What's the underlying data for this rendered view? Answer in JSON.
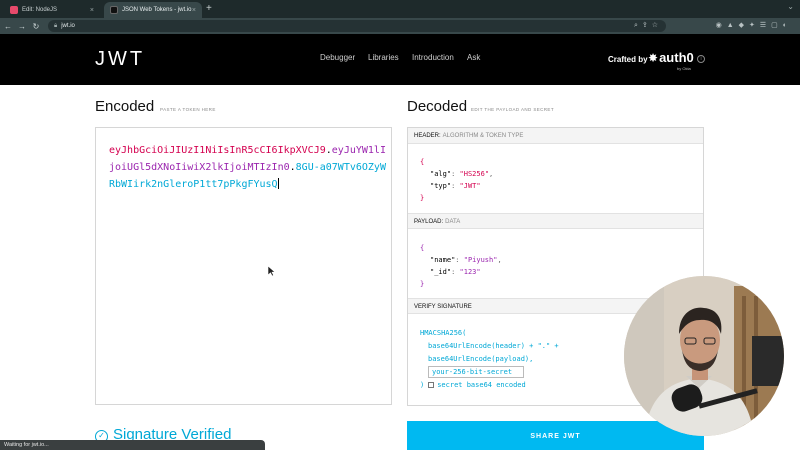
{
  "browser": {
    "tabs": [
      {
        "title": "Edit: NodeJS",
        "close": "×"
      },
      {
        "title": "JSON Web Tokens - jwt.io",
        "close": "×"
      }
    ],
    "new_tab": "+",
    "url": "jwt.io",
    "status_text": "Waiting for jwt.io..."
  },
  "site": {
    "logo": "JWT",
    "nav": [
      "Debugger",
      "Libraries",
      "Introduction",
      "Ask"
    ],
    "crafted_by": "Crafted by",
    "brand": "auth0",
    "brand_sub": "by Okta"
  },
  "encoded": {
    "title": "Encoded",
    "hint": "PASTE A TOKEN HERE",
    "token": {
      "header": "eyJhbGciOiJIUzI1NiIsInR5cCI6IkpXVCJ9",
      "payload": "eyJuYW1lIjoiUGl5dXNoIiwiX2lkIjoiMTIzIn0",
      "signature": "8GU-a07WTv6OZyWRbWIirk2nGleroP1tt7pPkgFYusQ"
    }
  },
  "decoded": {
    "title": "Decoded",
    "hint": "EDIT THE PAYLOAD AND SECRET",
    "header_panel": {
      "label": "HEADER:",
      "sub": "ALGORITHM & TOKEN TYPE"
    },
    "header_json": {
      "alg": "HS256",
      "typ": "JWT"
    },
    "payload_panel": {
      "label": "PAYLOAD:",
      "sub": "DATA"
    },
    "payload_json": {
      "name": "Piyush",
      "_id": "123"
    },
    "verify_panel": {
      "label": "VERIFY SIGNATURE"
    },
    "verify": {
      "fn": "HMACSHA256(",
      "line1": "base64UrlEncode(header) + \".\" +",
      "line2": "base64UrlEncode(payload),",
      "secret_value": "your-256-bit-secret",
      "close": ")",
      "checkbox_label": "secret base64 encoded"
    }
  },
  "signature_verified": "Signature Verified",
  "share_label": "SHARE JWT",
  "colors": {
    "header_token": "#d4004f",
    "payload_token": "#9b26af",
    "signature_token": "#00a8d6",
    "share_button": "#00b9f1"
  }
}
